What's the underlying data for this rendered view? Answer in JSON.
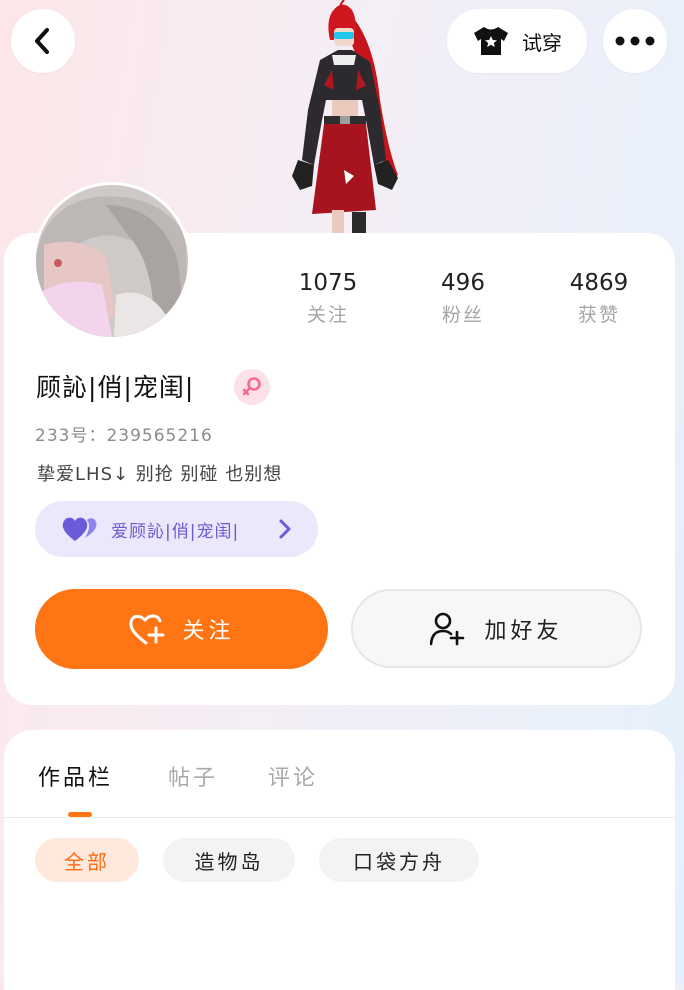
{
  "header": {
    "try_on_label": "试穿",
    "icons": {
      "back": "chevron-left-icon",
      "try_on": "tshirt-icon",
      "more": "more-dots-icon"
    }
  },
  "profile": {
    "username": "顾訫|俏|宠闺|",
    "gender_icon": "female-icon",
    "uid_label": "233号：",
    "uid": "239565216",
    "bio": "挚爱LHS↓ 别抢 别碰 也别想",
    "love_pill_label": "爱顾訫|俏|宠闺|"
  },
  "stats": [
    {
      "value": "1075",
      "label": "关注"
    },
    {
      "value": "496",
      "label": "粉丝"
    },
    {
      "value": "4869",
      "label": "获赞"
    }
  ],
  "actions": {
    "follow_label": "关注",
    "add_friend_label": "加好友"
  },
  "tabs": [
    {
      "label": "作品栏",
      "active": true
    },
    {
      "label": "帖子",
      "active": false
    },
    {
      "label": "评论",
      "active": false
    }
  ],
  "filters": [
    {
      "label": "全部",
      "active": true
    },
    {
      "label": "造物岛",
      "active": false
    },
    {
      "label": "口袋方舟",
      "active": false
    }
  ],
  "colors": {
    "accent": "#ff7413",
    "purple": "#6a5bd6",
    "pink": "#f46b90"
  }
}
